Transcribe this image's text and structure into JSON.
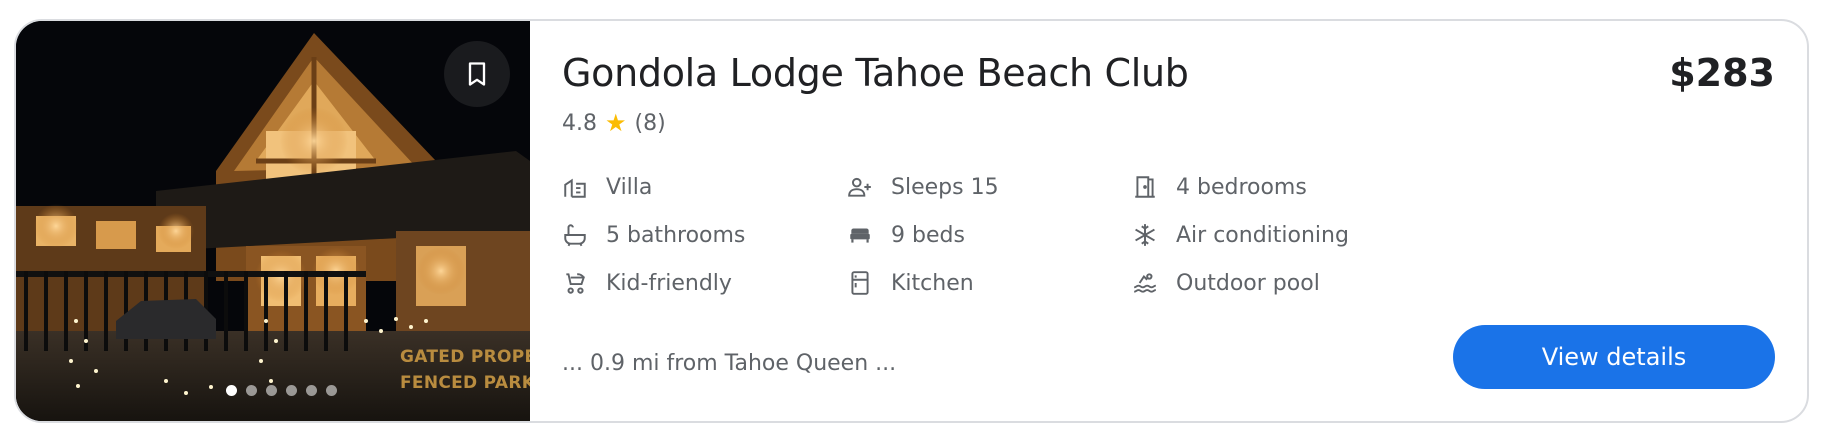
{
  "listing": {
    "title": "Gondola Lodge Tahoe Beach Club",
    "price": "$283",
    "rating": "4.8",
    "review_count": "(8)",
    "star_color": "#fbbc04",
    "snippet": "... 0.9 mi from Tahoe Queen ...",
    "view_details_label": "View details",
    "accent_color": "#1a73e8"
  },
  "photo": {
    "caption_line1": "GATED PROPER",
    "caption_line2": "FENCED PARKIN",
    "bookmark_icon": "bookmark-icon",
    "carousel_total": 6,
    "carousel_active": 1
  },
  "amenities": [
    {
      "label": "Villa",
      "icon": "villa-icon"
    },
    {
      "label": "Sleeps 15",
      "icon": "sleeps-icon"
    },
    {
      "label": "4 bedrooms",
      "icon": "bedroom-door-icon"
    },
    {
      "label": "5 bathrooms",
      "icon": "bathtub-icon"
    },
    {
      "label": "9 beds",
      "icon": "bed-icon"
    },
    {
      "label": "Air conditioning",
      "icon": "snowflake-icon"
    },
    {
      "label": "Kid-friendly",
      "icon": "stroller-icon"
    },
    {
      "label": "Kitchen",
      "icon": "kitchen-icon"
    },
    {
      "label": "Outdoor pool",
      "icon": "pool-icon"
    }
  ]
}
